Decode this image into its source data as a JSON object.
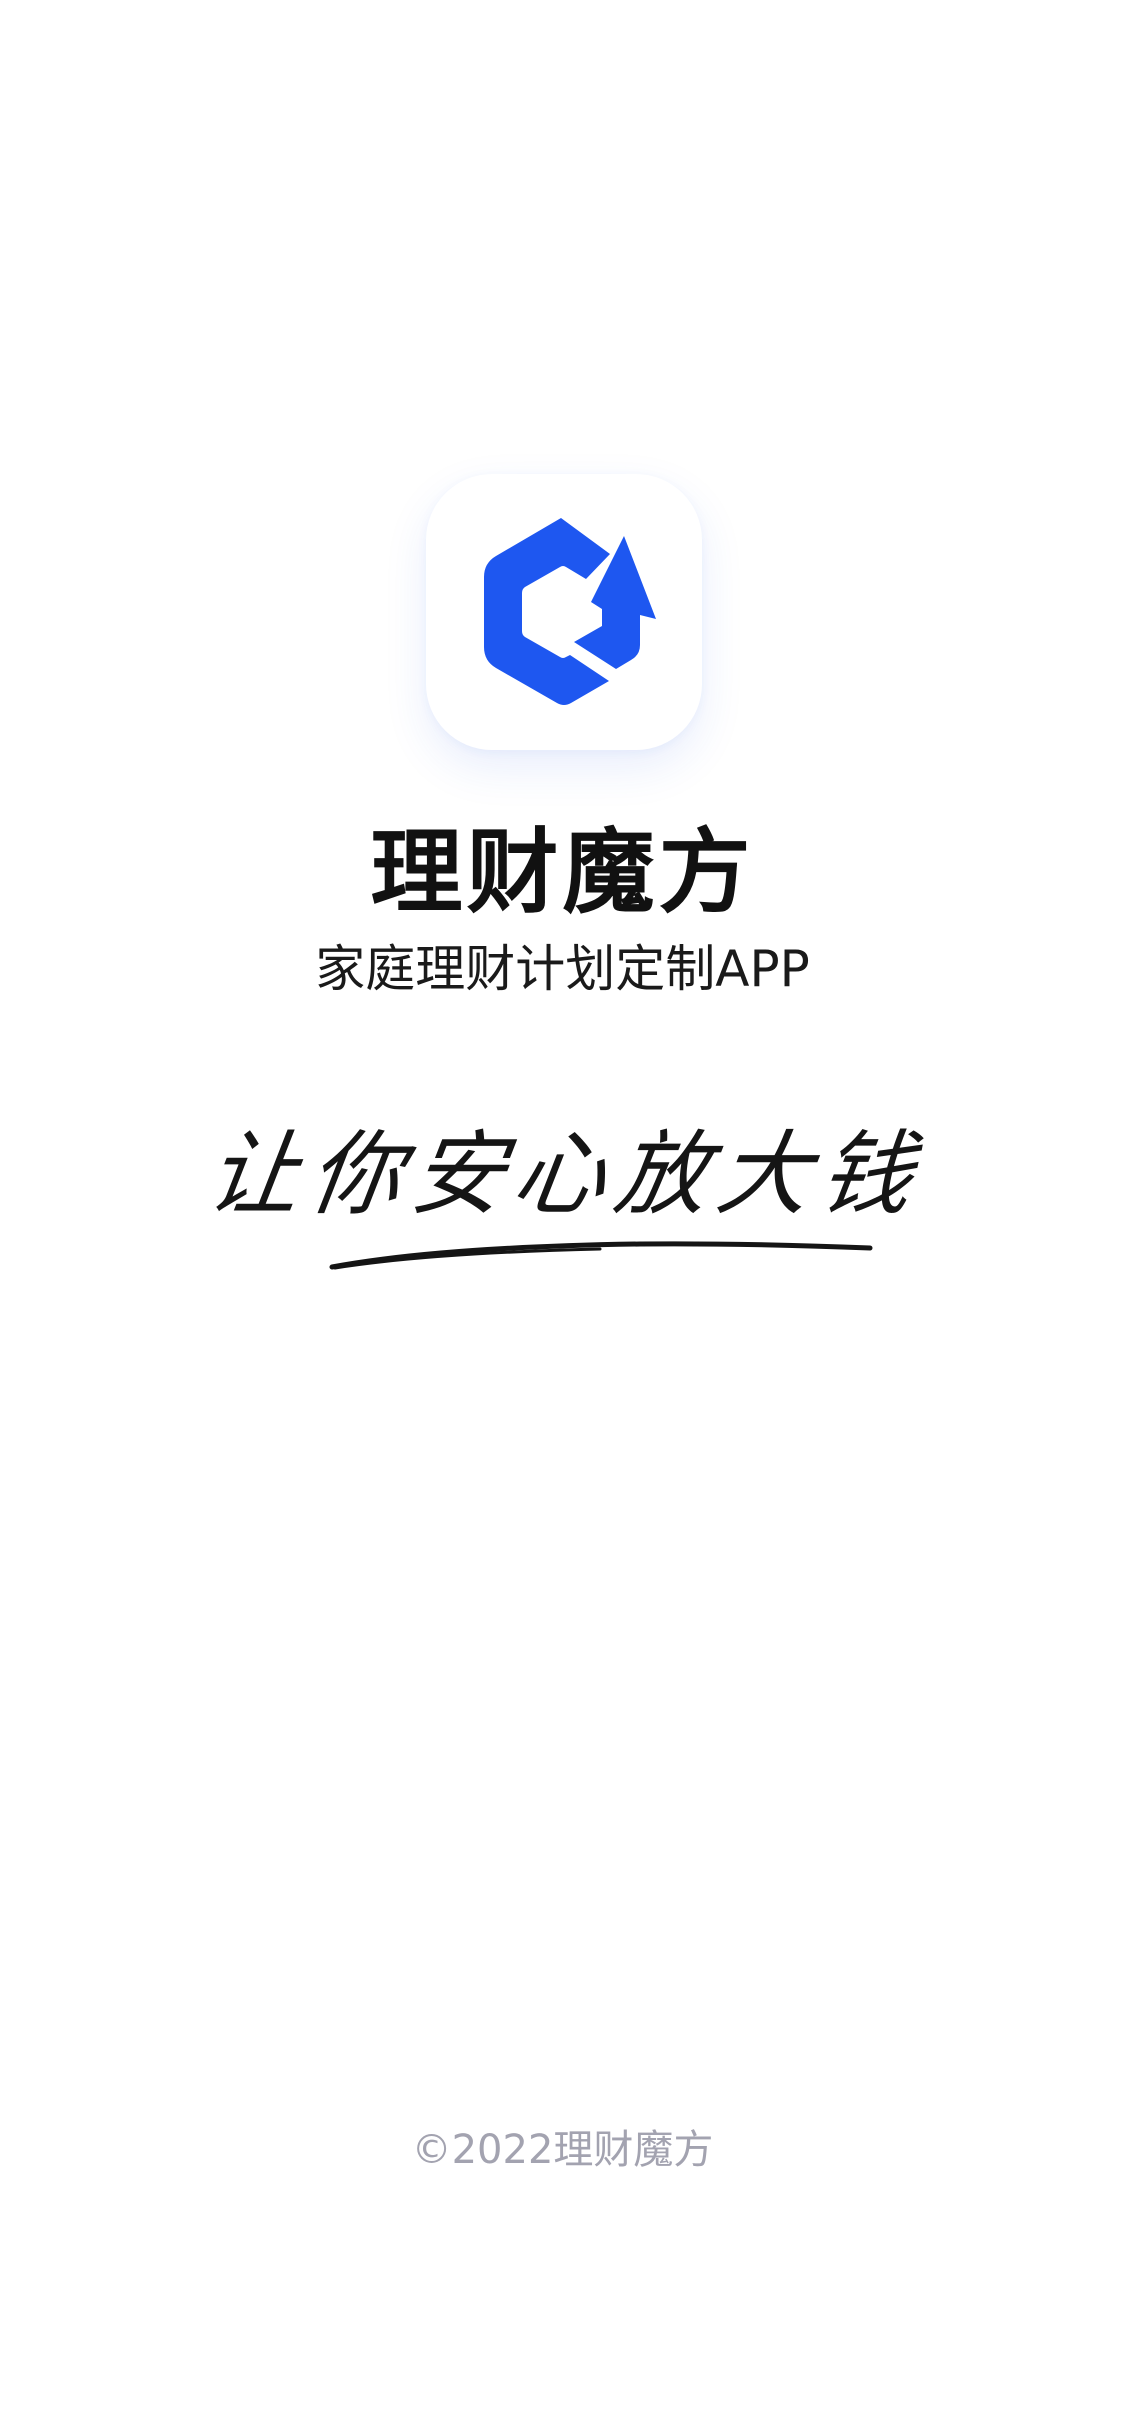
{
  "app": {
    "name": "理财魔方",
    "subtitle": "家庭理财计划定制APP",
    "slogan": "让你安心放大钱",
    "copyright": "©2022理财魔方"
  },
  "icons": {
    "logo": "cube-arrow-logo-icon"
  },
  "colors": {
    "brand": "#1E57F0",
    "background": "#FFFFFF",
    "title": "#111111",
    "copyright": "#A3A3B0"
  }
}
